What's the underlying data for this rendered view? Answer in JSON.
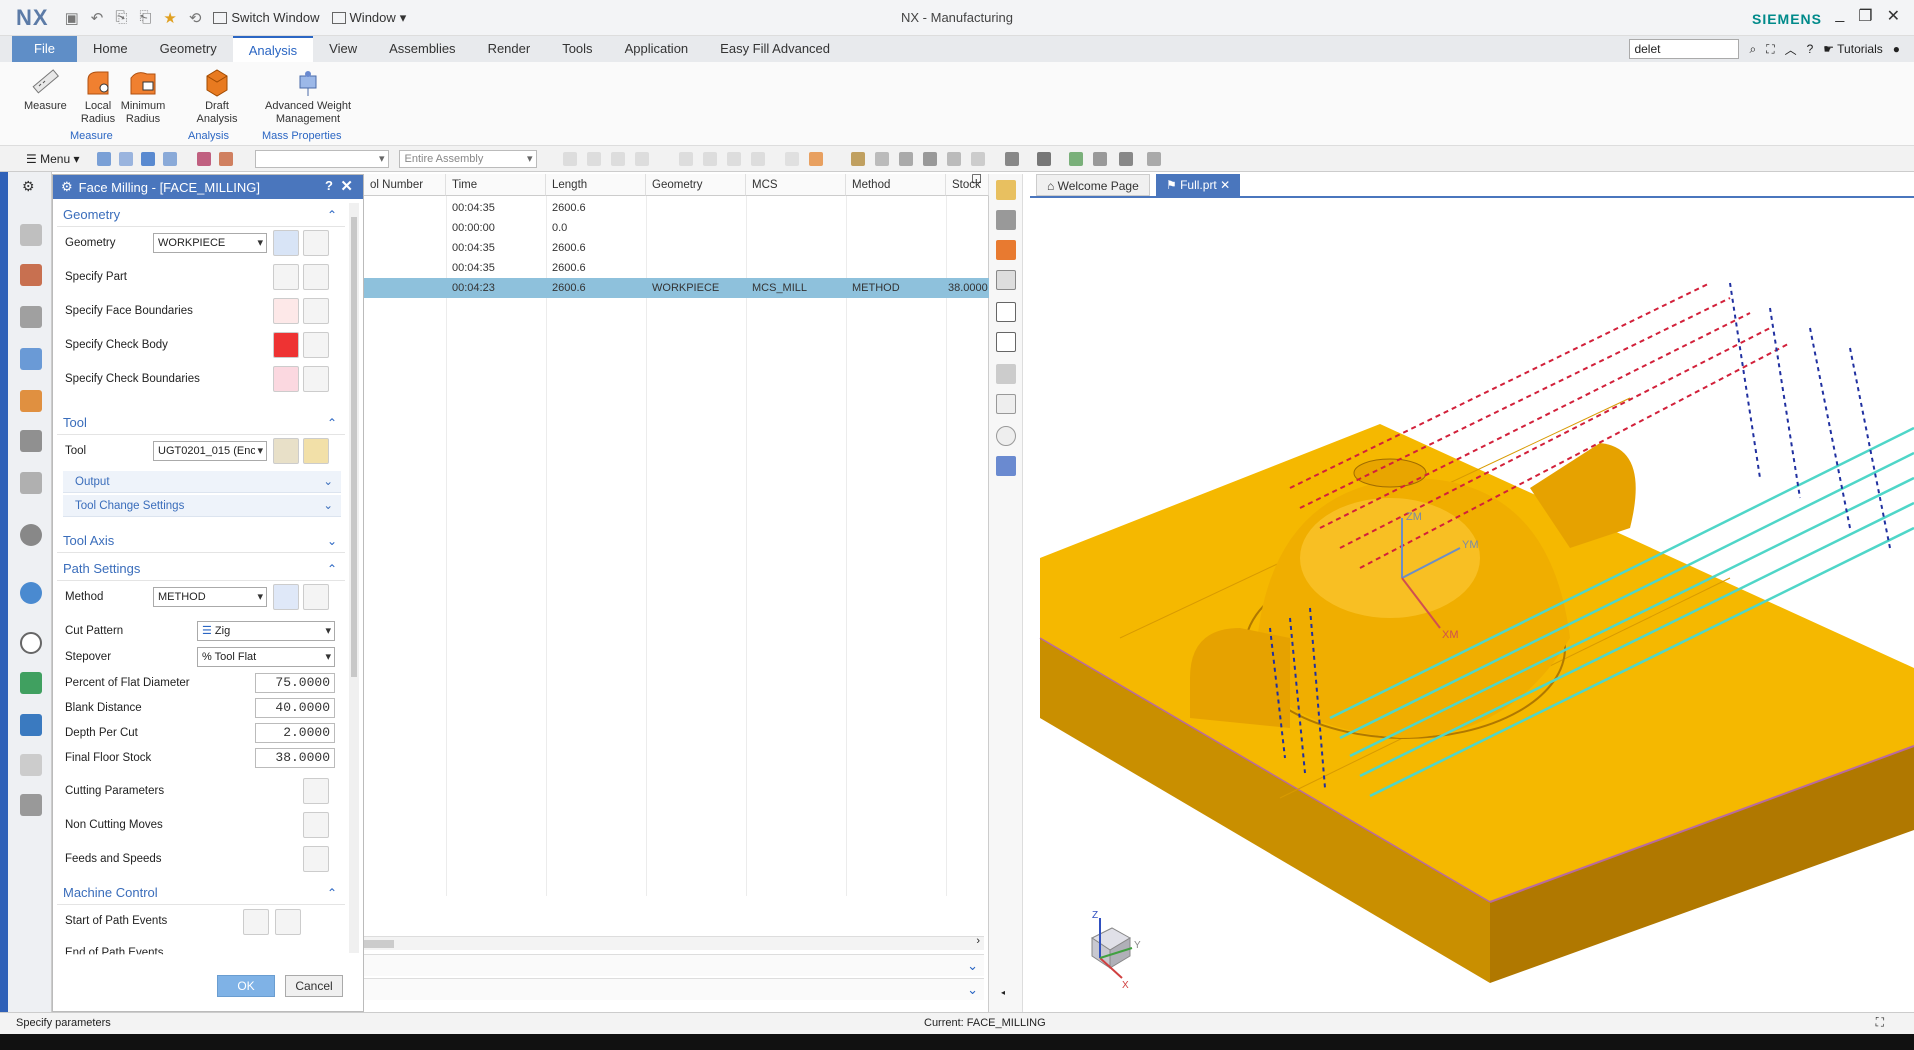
{
  "titlebar": {
    "logo": "NX",
    "switch_window": "Switch Window",
    "window": "Window",
    "app_title": "NX - Manufacturing",
    "brand": "SIEMENS"
  },
  "menubar": {
    "tabs": [
      "File",
      "Home",
      "Geometry",
      "Analysis",
      "View",
      "Assemblies",
      "Render",
      "Tools",
      "Application",
      "Easy Fill Advanced"
    ],
    "active_tab": "Analysis",
    "search_value": "delet",
    "tutorials": "Tutorials"
  },
  "ribbon": {
    "buttons": [
      {
        "label": "Measure"
      },
      {
        "label": "Local Radius"
      },
      {
        "label": "Minimum Radius"
      },
      {
        "label": "Draft Analysis"
      },
      {
        "label": "Advanced Weight Management"
      }
    ],
    "groups": [
      "Measure",
      "Analysis",
      "Mass Properties"
    ]
  },
  "toolbar": {
    "menu_label": "Menu",
    "selection_filter": "",
    "assembly_filter": "Entire Assembly"
  },
  "dialog": {
    "title": "Face Milling - [FACE_MILLING]",
    "help": "?",
    "close": "✕",
    "sections": {
      "geometry": "Geometry",
      "tool": "Tool",
      "tool_axis": "Tool Axis",
      "path_settings": "Path Settings",
      "machine_control": "Machine Control"
    },
    "geometry_label": "Geometry",
    "geometry_value": "WORKPIECE",
    "specify_part": "Specify Part",
    "specify_face_boundaries": "Specify Face Boundaries",
    "specify_check_body": "Specify Check Body",
    "specify_check_boundaries": "Specify Check Boundaries",
    "tool_label": "Tool",
    "tool_value": "UGT0201_015 (Enc",
    "output": "Output",
    "tool_change_settings": "Tool Change Settings",
    "method_label": "Method",
    "method_value": "METHOD",
    "cut_pattern_label": "Cut Pattern",
    "cut_pattern_value": "Zig",
    "stepover_label": "Stepover",
    "stepover_value": "% Tool Flat",
    "percent_flat_label": "Percent of Flat Diameter",
    "percent_flat_value": "75.0000",
    "blank_distance_label": "Blank Distance",
    "blank_distance_value": "40.0000",
    "depth_per_cut_label": "Depth Per Cut",
    "depth_per_cut_value": "2.0000",
    "final_floor_stock_label": "Final Floor Stock",
    "final_floor_stock_value": "38.0000",
    "cutting_parameters": "Cutting Parameters",
    "non_cutting_moves": "Non Cutting Moves",
    "feeds_and_speeds": "Feeds and Speeds",
    "start_of_path_events": "Start of Path Events",
    "end_of_path_events": "End of Path Events",
    "ok": "OK",
    "cancel": "Cancel"
  },
  "oplist": {
    "headers": [
      "ol Number",
      "Time",
      "Length",
      "Geometry",
      "MCS",
      "Method",
      "Stock"
    ],
    "rows": [
      [
        "",
        "00:04:35",
        "2600.6",
        "",
        "",
        "",
        ""
      ],
      [
        "",
        "00:00:00",
        "0.0",
        "",
        "",
        "",
        ""
      ],
      [
        "",
        "00:04:35",
        "2600.6",
        "",
        "",
        "",
        ""
      ],
      [
        "",
        "00:04:35",
        "2600.6",
        "",
        "",
        "",
        ""
      ],
      [
        "",
        "00:04:23",
        "2600.6",
        "WORKPIECE",
        "MCS_MILL",
        "METHOD",
        "38.0000"
      ]
    ],
    "selected_row": 4
  },
  "graphics": {
    "tabs": [
      "Welcome Page",
      "Full.prt"
    ],
    "axis_labels": {
      "zm": "ZM",
      "ym": "YM",
      "xm": "XM",
      "z": "Z",
      "y": "Y",
      "x": "X"
    }
  },
  "statusbar": {
    "left": "Specify parameters",
    "center": "Current: FACE_MILLING"
  },
  "colors": {
    "accent": "#2b66c3",
    "dialog_title": "#4a76bd",
    "selected_row": "#8ec1dc",
    "part_yellow": "#f5b800",
    "toolpath_cyan": "#4fd6c8",
    "toolpath_red": "#d2203a",
    "toolpath_blue": "#2030a0"
  }
}
